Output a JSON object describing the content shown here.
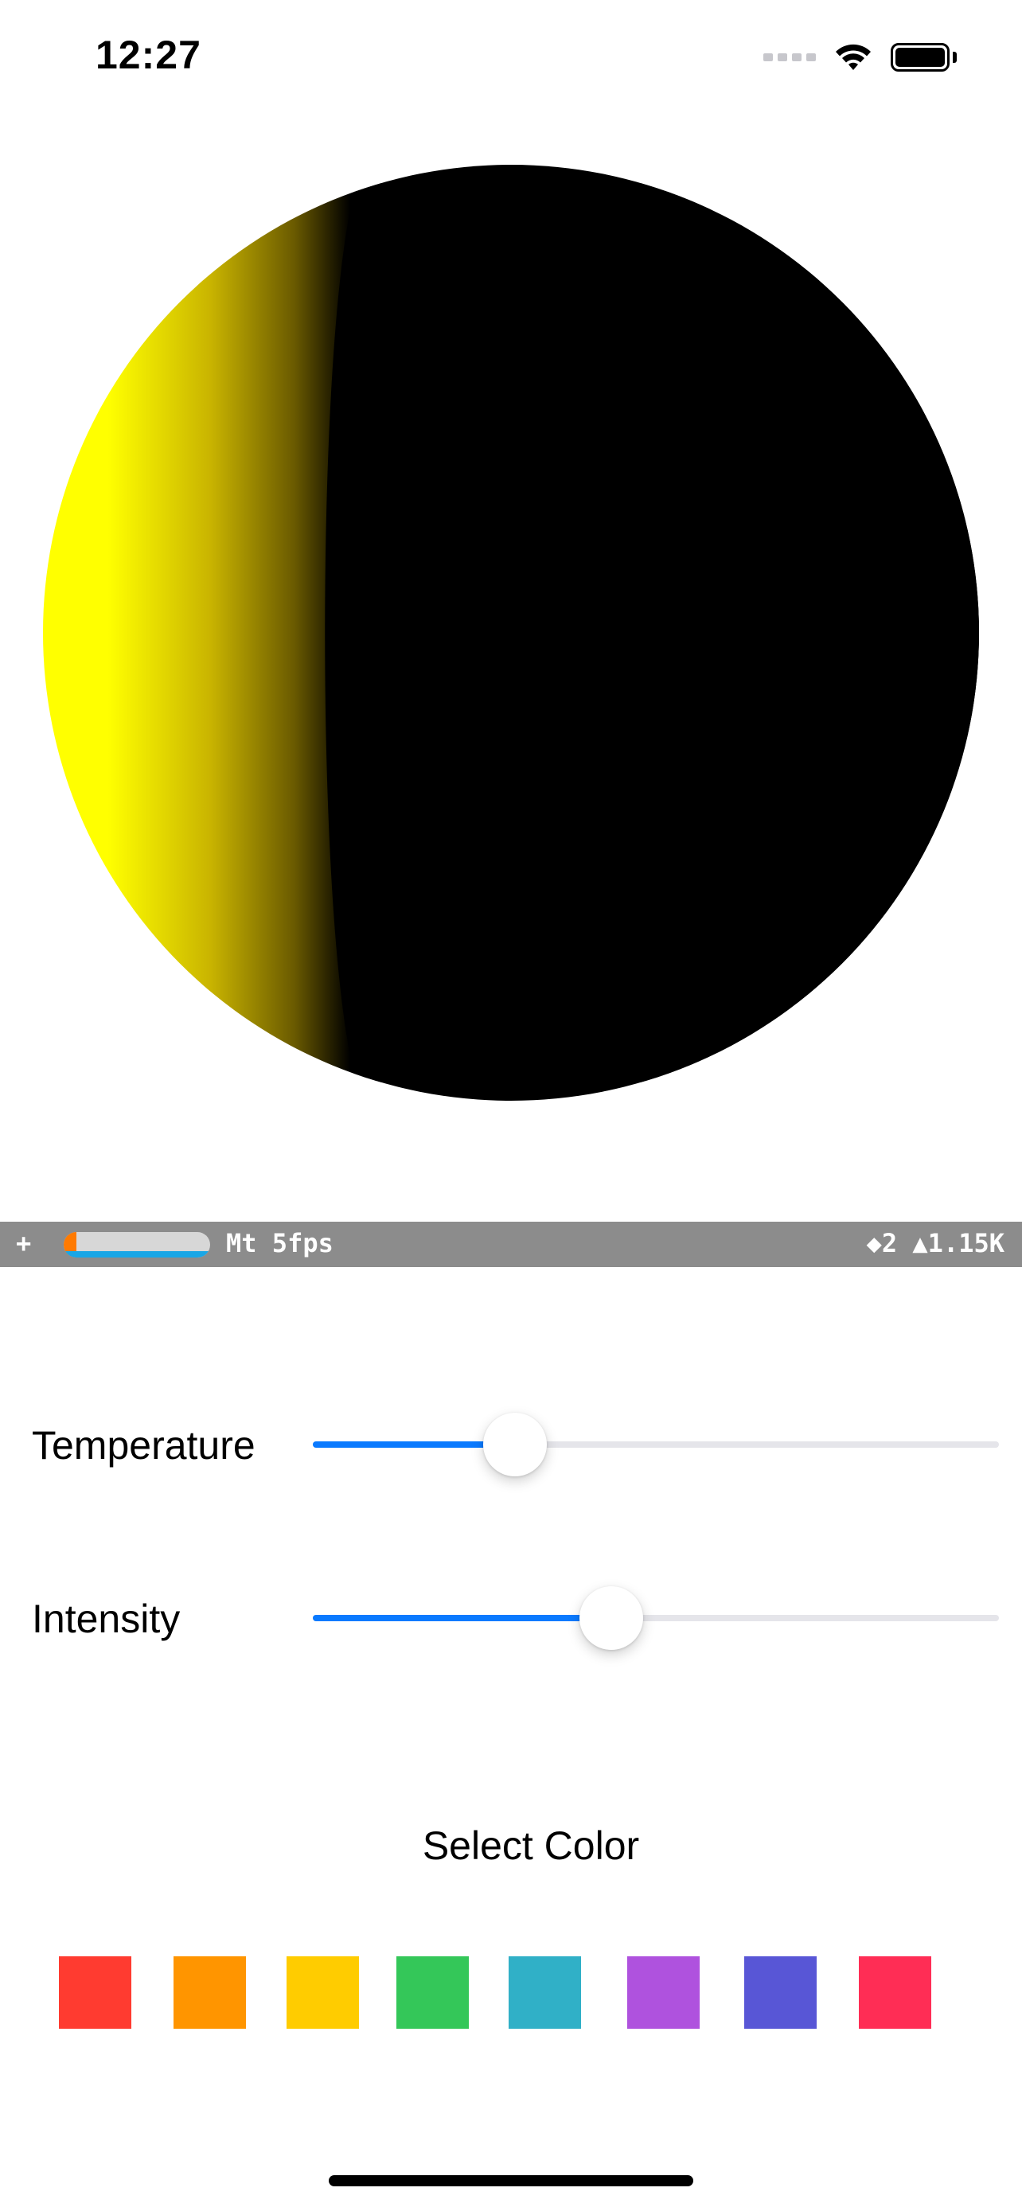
{
  "status_bar": {
    "time": "12:27",
    "icons": [
      "cellular-signal-icon",
      "wifi-icon",
      "battery-icon"
    ]
  },
  "scene": {
    "light_color": "#ffff00",
    "shadow_color": "#000000"
  },
  "stats": {
    "plus": "+",
    "fps": "Mt 5fps",
    "counts": "◆2 ▲1.15K"
  },
  "controls": {
    "temperature": {
      "label": "Temperature",
      "value": 0.295
    },
    "intensity": {
      "label": "Intensity",
      "value": 0.435
    }
  },
  "color_picker": {
    "title": "Select Color",
    "swatches": [
      "#ff3b30",
      "#ff9500",
      "#ffcc00",
      "#34c759",
      "#30b0c7",
      "#af52de",
      "#5856d6",
      "#ff2d55"
    ]
  }
}
